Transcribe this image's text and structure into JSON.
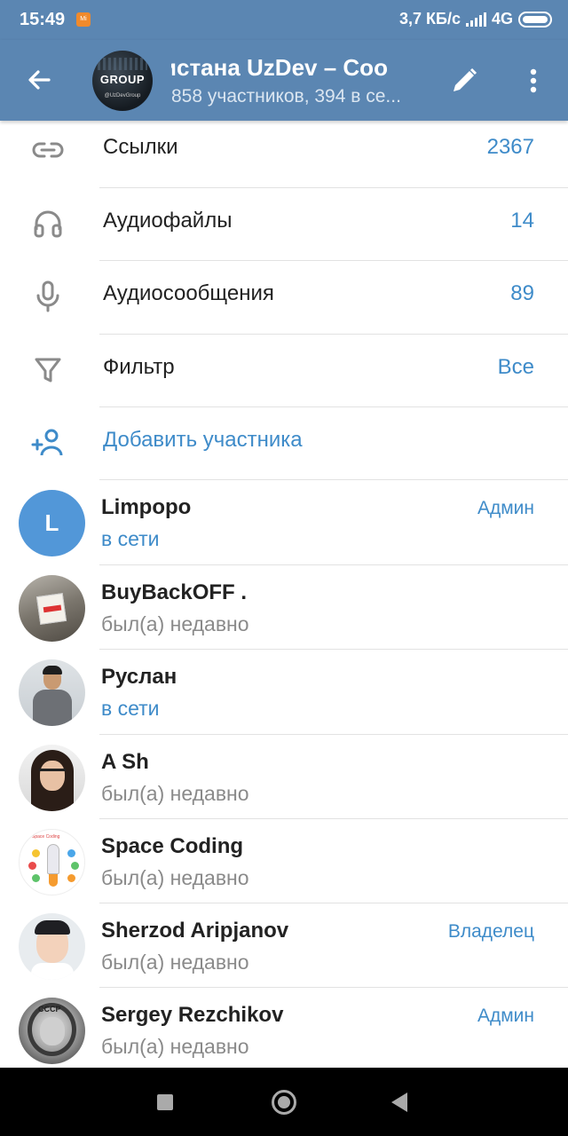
{
  "status_bar": {
    "time": "15:49",
    "notification_badge": "Mi",
    "network_speed": "3,7 КБ/с",
    "network_type": "4G",
    "icons": [
      "signal-icon",
      "battery-icon"
    ]
  },
  "header": {
    "title": "истана   UzDev – Coo",
    "subtitle": "858 участников, 394 в се...",
    "avatar_text": "GROUP",
    "avatar_subtext": "@UzDevGroup",
    "accent_color": "#5b86b2"
  },
  "media_rows": [
    {
      "icon": "link-icon",
      "label": "Ссылки",
      "value": "2367"
    },
    {
      "icon": "headphones-icon",
      "label": "Аудиофайлы",
      "value": "14"
    },
    {
      "icon": "microphone-icon",
      "label": "Аудиосообщения",
      "value": "89"
    },
    {
      "icon": "filter-icon",
      "label": "Фильтр",
      "value": "Все"
    }
  ],
  "add_member": {
    "icon": "add-user-icon",
    "label": "Добавить участника"
  },
  "members": [
    {
      "name": "Limpopo",
      "status": "в сети",
      "online": true,
      "role": "Админ",
      "avatar_letter": "L"
    },
    {
      "name": "BuyBackOFF .",
      "status": "был(а) недавно",
      "online": false,
      "role": ""
    },
    {
      "name": "Руслан",
      "status": "в сети",
      "online": true,
      "role": ""
    },
    {
      "name": "A Sh",
      "status": "был(а) недавно",
      "online": false,
      "role": ""
    },
    {
      "name": "Space Coding",
      "status": "был(а) недавно",
      "online": false,
      "role": "",
      "avatar_caption": "Space Coding"
    },
    {
      "name": "Sherzod Aripjanov",
      "status": "был(а) недавно",
      "online": false,
      "role": "Владелец"
    },
    {
      "name": "Sergey Rezchikov",
      "status": "был(а) недавно",
      "online": false,
      "role": "Админ",
      "avatar_caption": "CCCP"
    }
  ],
  "colors": {
    "link_blue": "#3e8bc9",
    "muted_gray": "#8a8a8a",
    "avatar_blue": "#5297d8"
  }
}
